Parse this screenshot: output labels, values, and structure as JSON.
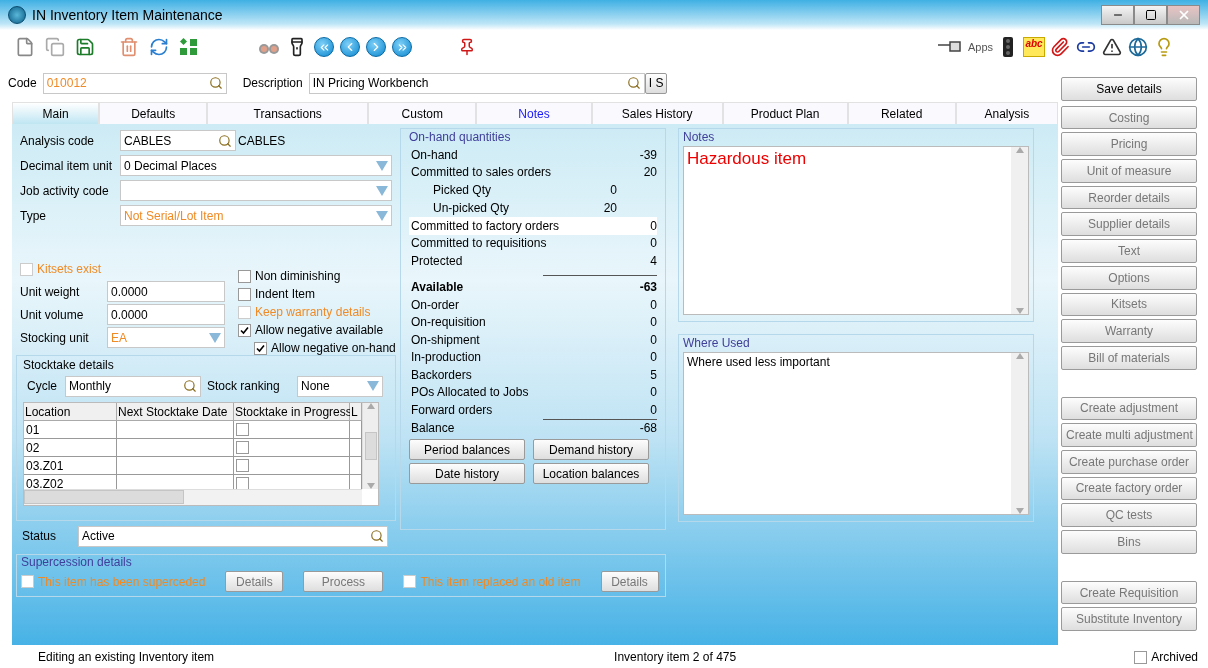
{
  "window": {
    "title": "IN Inventory Item Maintenance"
  },
  "toolbar": {
    "apps_label": "Apps",
    "spellcheck_label": "abc"
  },
  "code": {
    "label": "Code",
    "value": "010012"
  },
  "description": {
    "label": "Description",
    "value": "IN Pricing Workbench",
    "button": "I S"
  },
  "tabs": [
    {
      "label": "Main",
      "selected": true,
      "has_content": false
    },
    {
      "label": "Defaults",
      "selected": false,
      "has_content": false
    },
    {
      "label": "Transactions",
      "selected": false,
      "has_content": false
    },
    {
      "label": "Custom",
      "selected": false,
      "has_content": false
    },
    {
      "label": "Notes",
      "selected": false,
      "has_content": true
    },
    {
      "label": "Sales History",
      "selected": false,
      "has_content": false
    },
    {
      "label": "Product Plan",
      "selected": false,
      "has_content": false
    },
    {
      "label": "Related",
      "selected": false,
      "has_content": false
    },
    {
      "label": "Analysis",
      "selected": false,
      "has_content": false
    }
  ],
  "fields": [
    {
      "label": "Analysis code",
      "value": "CABLES",
      "kind": "lookup",
      "highlighted": false,
      "description": "CABLES"
    },
    {
      "label": "Decimal item unit",
      "value": "0 Decimal Places",
      "kind": "dropdown",
      "highlighted": false
    },
    {
      "label": "Job activity code",
      "kind": "dropdown"
    },
    {
      "label": "Type",
      "value": "Not Serial/Lot Item",
      "kind": "dropdown",
      "highlighted": true
    }
  ],
  "kitsets": {
    "label": "Kitsets exist",
    "checked": false,
    "highlighted": true
  },
  "measures": [
    {
      "label": "Unit weight",
      "value": "0.0000",
      "kind": "text",
      "highlighted": false
    },
    {
      "label": "Unit volume",
      "value": "0.0000",
      "kind": "text",
      "highlighted": false
    },
    {
      "label": "Stocking unit",
      "value": "EA",
      "kind": "dropdown",
      "highlighted": true
    }
  ],
  "options": [
    {
      "label": "Non diminishing",
      "checked": false,
      "highlighted": false
    },
    {
      "label": "Indent Item",
      "checked": false,
      "highlighted": false
    },
    {
      "label": "Keep warranty details",
      "checked": false,
      "highlighted": true
    },
    {
      "label": "Allow negative available",
      "checked": true,
      "highlighted": false,
      "children": [
        {
          "label": "Allow negative on-hand",
          "checked": true,
          "highlighted": false
        }
      ]
    }
  ],
  "stocktake": {
    "title": "Stocktake details",
    "cycle": {
      "label": "Cycle",
      "value": "Monthly"
    },
    "ranking": {
      "label": "Stock ranking",
      "value": "None"
    },
    "columns": [
      "Location",
      "Next Stocktake Date",
      "Stocktake in Progress",
      "L"
    ],
    "rows": [
      {
        "location": "01",
        "in_progress": false
      },
      {
        "location": "02",
        "in_progress": false
      },
      {
        "location": "03.Z01",
        "in_progress": false
      },
      {
        "location": "03.Z02",
        "in_progress": false
      }
    ]
  },
  "status": {
    "label": "Status",
    "value": "Active"
  },
  "quantities": {
    "title": "On-hand quantities",
    "rows": [
      {
        "label": "On-hand",
        "value": "-39",
        "kind": "line",
        "selected": false
      },
      {
        "label": "Committed to sales orders",
        "value": "20",
        "kind": "line",
        "selected": false
      },
      {
        "label": "Picked Qty",
        "value": "0",
        "kind": "sub",
        "selected": false
      },
      {
        "label": "Un-picked Qty",
        "value": "20",
        "kind": "sub",
        "selected": false
      },
      {
        "label": "Committed to factory orders",
        "value": "0",
        "kind": "line",
        "selected": true
      },
      {
        "label": "Committed to requisitions",
        "value": "0",
        "kind": "line",
        "selected": false
      },
      {
        "label": "Protected",
        "value": "4",
        "kind": "line",
        "selected": false
      },
      {
        "label": "Available",
        "value": "-63",
        "kind": "total",
        "selected": false
      },
      {
        "label": "On-order",
        "value": "0",
        "kind": "line",
        "selected": false
      },
      {
        "label": "On-requisition",
        "value": "0",
        "kind": "line",
        "selected": false
      },
      {
        "label": "On-shipment",
        "value": "0",
        "kind": "line",
        "selected": false
      },
      {
        "label": "In-production",
        "value": "0",
        "kind": "line",
        "selected": false
      },
      {
        "label": "Backorders",
        "value": "5",
        "kind": "line",
        "selected": false
      },
      {
        "label": "POs Allocated to Jobs",
        "value": "0",
        "kind": "line",
        "selected": false
      },
      {
        "label": "Forward orders",
        "value": "0",
        "kind": "line",
        "selected": false
      },
      {
        "label": "Balance",
        "value": "-68",
        "kind": "balance",
        "selected": false
      }
    ],
    "buttons": [
      "Period balances",
      "Demand history",
      "Date history",
      "Location balances"
    ]
  },
  "notes": {
    "title": "Notes",
    "text": "Hazardous item"
  },
  "where_used": {
    "title": "Where Used",
    "text": "Where used less important"
  },
  "supercession": {
    "title": "Supercession details",
    "items": [
      {
        "kind": "checkbox",
        "label": "This item has been superceded",
        "checked": false
      },
      {
        "kind": "button",
        "label": "Details"
      },
      {
        "kind": "button",
        "label": "Process"
      },
      {
        "kind": "checkbox",
        "label": "This item replaced an old item",
        "checked": false
      },
      {
        "kind": "button",
        "label": "Details"
      }
    ]
  },
  "side_buttons": [
    [
      {
        "label": "Save details",
        "disabled": false
      }
    ],
    [
      {
        "label": "Costing",
        "disabled": true
      },
      {
        "label": "Pricing",
        "disabled": true
      },
      {
        "label": "Unit of measure",
        "disabled": true
      },
      {
        "label": "Reorder details",
        "disabled": true
      },
      {
        "label": "Supplier details",
        "disabled": true
      },
      {
        "label": "Text",
        "disabled": true
      },
      {
        "label": "Options",
        "disabled": true
      },
      {
        "label": "Kitsets",
        "disabled": true
      },
      {
        "label": "Warranty",
        "disabled": true
      },
      {
        "label": "Bill of materials",
        "disabled": true
      }
    ],
    [
      {
        "label": "Create adjustment",
        "disabled": true
      },
      {
        "label": "Create multi adjustment",
        "disabled": true
      },
      {
        "label": "Create purchase order",
        "disabled": true
      },
      {
        "label": "Create factory order",
        "disabled": true
      },
      {
        "label": "QC tests",
        "disabled": true
      },
      {
        "label": "Bins",
        "disabled": true
      }
    ],
    [
      {
        "label": "Create Requisition",
        "disabled": true
      },
      {
        "label": "Substitute Inventory",
        "disabled": true
      }
    ]
  ],
  "status_bar": {
    "message": "Editing an existing Inventory item",
    "position": "Inventory item 2 of 475",
    "archived": {
      "label": "Archived",
      "checked": false
    }
  }
}
